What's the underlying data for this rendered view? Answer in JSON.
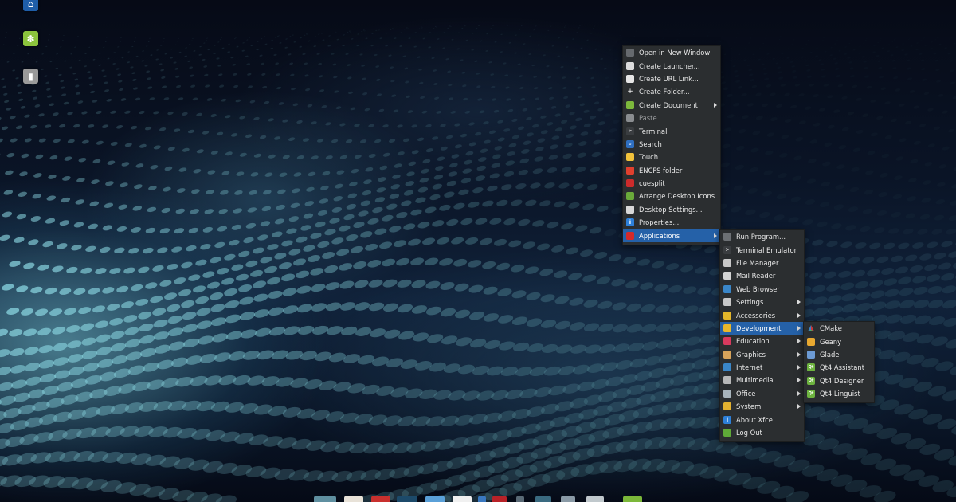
{
  "desktop": {
    "icons": [
      {
        "name": "home",
        "icon": "home-icon",
        "glyph": "⌂",
        "color": "#1f5ea8"
      },
      {
        "name": "network",
        "icon": "network-icon",
        "glyph": "✽",
        "color": "#8cc43d"
      },
      {
        "name": "usb-drive",
        "icon": "usb-drive-icon",
        "glyph": "▮",
        "color": "#9a9a9a"
      }
    ]
  },
  "context_menu": {
    "items": [
      {
        "label": "Open in New Window",
        "icon": "open-window-icon",
        "color": "#666a6e"
      },
      {
        "label": "Create Launcher...",
        "icon": "launcher-icon",
        "color": "#dcdcdc"
      },
      {
        "label": "Create URL Link...",
        "icon": "url-link-icon",
        "color": "#e6e6e6"
      },
      {
        "label": "Create Folder...",
        "icon": "new-folder-icon",
        "color": "transparent"
      },
      {
        "label": "Create Document",
        "icon": "document-icon",
        "color": "#7db83c",
        "submenu": true
      },
      {
        "label": "Paste",
        "icon": "paste-icon",
        "color": "#8a8d90",
        "disabled": true
      },
      {
        "label": "Terminal",
        "icon": "terminal-icon",
        "color": "#3a3d40"
      },
      {
        "label": "Search",
        "icon": "search-icon",
        "color": "#2f6fc0"
      },
      {
        "label": "Touch",
        "icon": "touch-icon",
        "color": "#f2c23b"
      },
      {
        "label": "ENCFS folder",
        "icon": "encfs-icon",
        "color": "#e2402e"
      },
      {
        "label": "cuesplit",
        "icon": "cuesplit-icon",
        "color": "#cc2b2b"
      },
      {
        "label": "Arrange Desktop Icons",
        "icon": "arrange-icon",
        "color": "#6aaa3a"
      },
      {
        "label": "Desktop Settings...",
        "icon": "desktop-settings-icon",
        "color": "#d8d8d8"
      },
      {
        "label": "Properties...",
        "icon": "info-icon",
        "color": "#2d7fd8"
      },
      {
        "label": "Applications",
        "icon": "applications-icon",
        "color": "#d42a2a",
        "submenu": true,
        "active": true
      }
    ]
  },
  "applications_menu": {
    "items": [
      {
        "label": "Run Program...",
        "icon": "run-program-icon",
        "color": "#6c7074"
      },
      {
        "label": "Terminal Emulator",
        "icon": "terminal-emulator-icon",
        "color": "#3a3d40"
      },
      {
        "label": "File Manager",
        "icon": "file-manager-icon",
        "color": "#c9c9c9"
      },
      {
        "label": "Mail Reader",
        "icon": "mail-icon",
        "color": "#d4d4d4"
      },
      {
        "label": "Web Browser",
        "icon": "web-browser-icon",
        "color": "#3a86c8"
      },
      {
        "label": "Settings",
        "icon": "settings-icon",
        "color": "#c8c8c8",
        "submenu": true
      },
      {
        "label": "Accessories",
        "icon": "accessories-icon",
        "color": "#e5b72a",
        "submenu": true
      },
      {
        "label": "Development",
        "icon": "development-icon",
        "color": "#e8b72c",
        "submenu": true,
        "active": true
      },
      {
        "label": "Education",
        "icon": "education-icon",
        "color": "#d83a5e",
        "submenu": true
      },
      {
        "label": "Graphics",
        "icon": "graphics-icon",
        "color": "#d8a35a",
        "submenu": true
      },
      {
        "label": "Internet",
        "icon": "internet-icon",
        "color": "#3a86c8",
        "submenu": true
      },
      {
        "label": "Multimedia",
        "icon": "multimedia-icon",
        "color": "#b8b8b8",
        "submenu": true
      },
      {
        "label": "Office",
        "icon": "office-icon",
        "color": "#a8b4bc",
        "submenu": true
      },
      {
        "label": "System",
        "icon": "system-icon",
        "color": "#e2b130",
        "submenu": true
      },
      {
        "label": "About Xfce",
        "icon": "about-icon",
        "color": "#2d7fd8"
      },
      {
        "label": "Log Out",
        "icon": "logout-icon",
        "color": "#5faa38"
      }
    ]
  },
  "development_menu": {
    "items": [
      {
        "label": "CMake",
        "icon": "cmake-icon",
        "color": "transparent"
      },
      {
        "label": "Geany",
        "icon": "geany-icon",
        "color": "#e8a830"
      },
      {
        "label": "Glade",
        "icon": "glade-icon",
        "color": "#6c9ad4"
      },
      {
        "label": "Qt4 Assistant",
        "icon": "qt-assistant-icon",
        "color": "#6db33f"
      },
      {
        "label": "Qt4 Designer",
        "icon": "qt-designer-icon",
        "color": "#6db33f"
      },
      {
        "label": "Qt4 Linguist",
        "icon": "qt-linguist-icon",
        "color": "#6db33f"
      }
    ]
  },
  "dock": {
    "items": [
      {
        "name": "files",
        "icon": "files-icon",
        "color": "#5f8fa0"
      },
      {
        "name": "browser",
        "icon": "browser-icon",
        "color": "#e8e2d8"
      },
      {
        "name": "media",
        "icon": "media-icon",
        "color": "#c8302e"
      },
      {
        "name": "terminal",
        "icon": "terminal-dock-icon",
        "color": "#1c4a6a"
      },
      {
        "name": "mail",
        "icon": "mail-dock-icon",
        "color": "#5aa0d8"
      },
      {
        "name": "calendar",
        "icon": "calendar-icon",
        "color": "#f0f0f0"
      },
      {
        "name": "info",
        "icon": "info-dock-icon",
        "color": "#3a78c0"
      },
      {
        "name": "record",
        "icon": "record-icon",
        "color": "#b82228"
      },
      {
        "name": "edit",
        "icon": "edit-icon",
        "color": "#5a6a76"
      },
      {
        "name": "app",
        "icon": "app-dock-icon",
        "color": "#3a6a80"
      },
      {
        "name": "tool",
        "icon": "tool-icon",
        "color": "#8a9aa6"
      },
      {
        "name": "network",
        "icon": "wifi-icon",
        "color": "#c0c8cc"
      },
      {
        "name": "system",
        "icon": "system-dock-icon",
        "color": "#7cb83a"
      }
    ]
  }
}
